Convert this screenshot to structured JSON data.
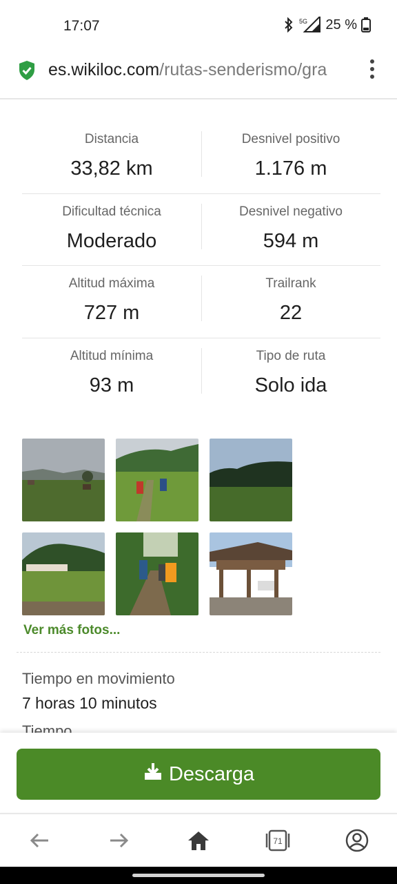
{
  "status": {
    "time": "17:07",
    "battery": "25 %",
    "network": "5G"
  },
  "browser": {
    "url_domain": "es.wikiloc.com",
    "url_path": "/rutas-senderismo/gra"
  },
  "stats": [
    {
      "left_label": "Distancia",
      "left_value": "33,82 km",
      "right_label": "Desnivel positivo",
      "right_value": "1.176 m"
    },
    {
      "left_label": "Dificultad técnica",
      "left_value": "Moderado",
      "right_label": "Desnivel negativo",
      "right_value": "594 m"
    },
    {
      "left_label": "Altitud máxima",
      "left_value": "727 m",
      "right_label": "Trailrank",
      "right_value": "22"
    },
    {
      "left_label": "Altitud mínima",
      "left_value": "93 m",
      "right_label": "Tipo de ruta",
      "right_value": "Solo ida"
    }
  ],
  "more_photos": "Ver más fotos...",
  "moving_time_label": "Tiempo en movimiento",
  "moving_time_value": "7 horas 10 minutos",
  "next_label": "Tiempo",
  "download_label": "Descarga",
  "tabs_count": "71",
  "colors": {
    "brand_green": "#4b8a27",
    "link_green": "#4c8a2b"
  }
}
